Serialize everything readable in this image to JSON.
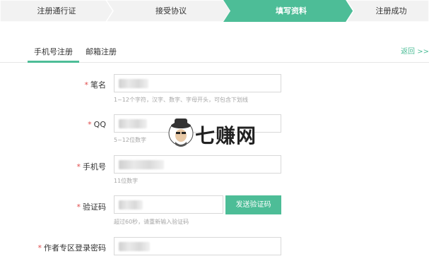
{
  "steps": [
    {
      "label": "注册通行证",
      "state": "done"
    },
    {
      "label": "接受协议",
      "state": "done"
    },
    {
      "label": "填写资料",
      "state": "active"
    },
    {
      "label": "注册成功",
      "state": "todo"
    }
  ],
  "tabs": [
    {
      "label": "手机号注册",
      "active": true
    },
    {
      "label": "邮箱注册",
      "active": false
    }
  ],
  "back_link": "返回 >>",
  "form": {
    "pen_name": {
      "label": "笔名",
      "required": "*",
      "hint": "1~12个字符，汉字、数字、字母开头，可包含下划线"
    },
    "qq": {
      "label": "QQ",
      "required": "*",
      "hint": "5~12位数字"
    },
    "phone": {
      "label": "手机号",
      "required": "*",
      "hint": "11位数字"
    },
    "code": {
      "label": "验证码",
      "required": "*",
      "hint": "超过60秒，请重新输入验证码",
      "button": "发送验证码"
    },
    "password": {
      "label": "作者专区登录密码",
      "required": "*"
    }
  },
  "watermark": {
    "text": "七赚网"
  },
  "colors": {
    "accent": "#4dbd97",
    "required": "#e04b4b",
    "hint": "#a6a6a6",
    "step_bg": "#f2f2f2"
  }
}
